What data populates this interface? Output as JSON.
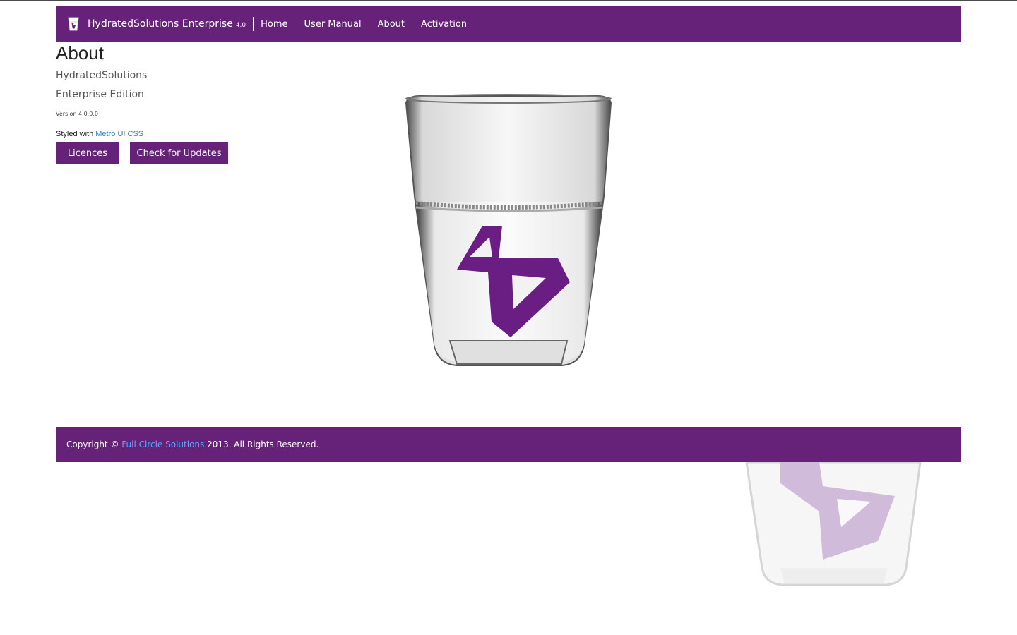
{
  "navbar": {
    "brand_name": "HydratedSolutions Enterprise",
    "brand_version": "4.0",
    "items": [
      {
        "label": "Home"
      },
      {
        "label": "User Manual"
      },
      {
        "label": "About"
      },
      {
        "label": "Activation"
      }
    ]
  },
  "content": {
    "title": "About",
    "product_name": "HydratedSolutions",
    "edition": "Enterprise Edition",
    "version": "Version 4.0.0.0",
    "styled_prefix": "Styled with",
    "styled_link": "Metro UI CSS",
    "buttons": {
      "licences": "Licences",
      "check_updates": "Check for Updates"
    }
  },
  "footer": {
    "prefix": "Copyright ©",
    "link": "Full Circle Solutions",
    "suffix": "2013. All Rights Reserved."
  },
  "colors": {
    "brand_purple": "#662179",
    "link_blue": "#2b7fc7",
    "footer_link_blue": "#55aaff"
  },
  "icons": {
    "brand": "glass-logo-icon",
    "hero": "water-glass-logo-image"
  }
}
